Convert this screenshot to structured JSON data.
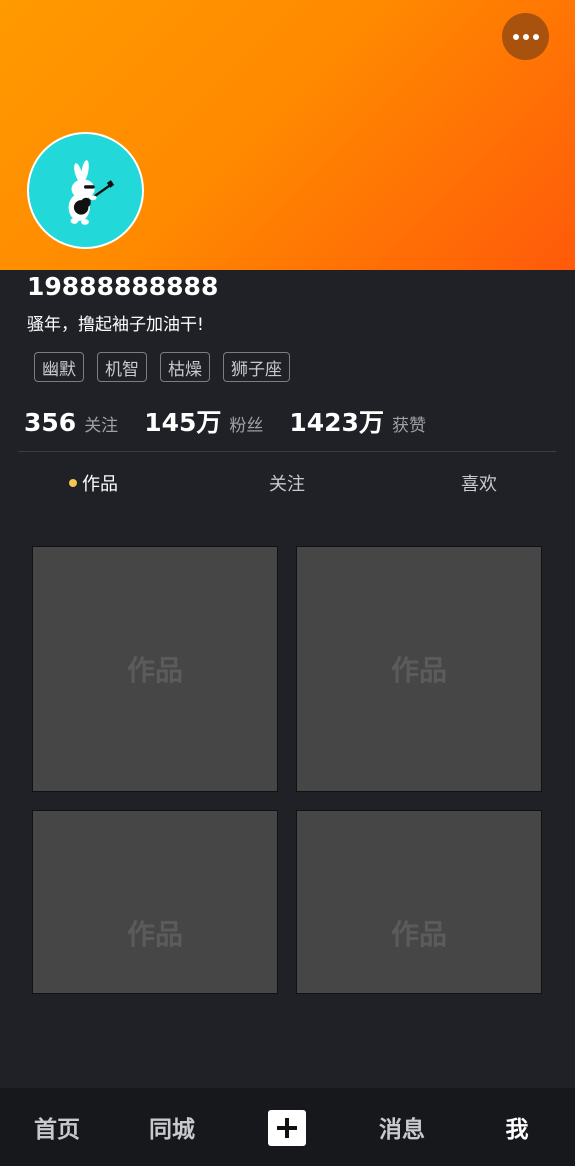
{
  "profile": {
    "nickname": "19888888888",
    "signature": "骚年，撸起袖子加油干!",
    "tags": [
      "幽默",
      "机智",
      "枯燥",
      "狮子座"
    ],
    "avatar_icon": "rabbit-guitar-avatar",
    "banner_colors": [
      "#ff9a00",
      "#ff5a0a"
    ]
  },
  "stats": [
    {
      "value": "356",
      "label": "关注"
    },
    {
      "value": "145万",
      "label": "粉丝"
    },
    {
      "value": "1423万",
      "label": "获赞"
    }
  ],
  "tabs": [
    {
      "label": "作品",
      "active": true
    },
    {
      "label": "关注",
      "active": false
    },
    {
      "label": "喜欢",
      "active": false
    }
  ],
  "works": [
    "作品",
    "作品",
    "作品",
    "作品"
  ],
  "bottom_nav": [
    {
      "label": "首页"
    },
    {
      "label": "同城"
    },
    {
      "label": "",
      "icon": "plus-icon"
    },
    {
      "label": "消息"
    },
    {
      "label": "我",
      "active": true
    }
  ],
  "colors": {
    "accent_dot": "#f5c451",
    "avatar_bg": "#22d8d8",
    "background": "#1f2126"
  }
}
